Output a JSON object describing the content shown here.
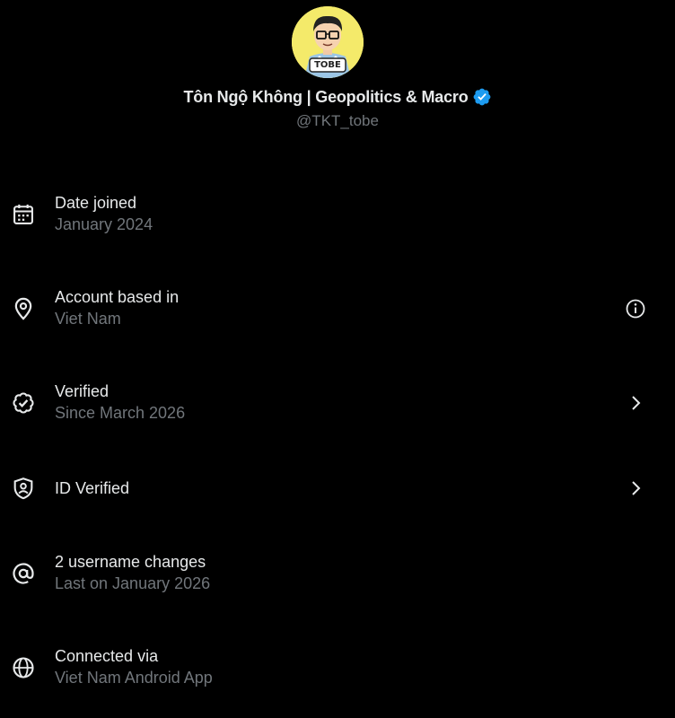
{
  "profile": {
    "display_name": "Tôn Ngộ Không | Geopolitics & Macro",
    "handle": "@TKT_tobe",
    "avatar_text": "TOBE",
    "avatar_bg": "#f4ea6a",
    "verified_color": "#1d9bf0"
  },
  "rows": [
    {
      "icon": "calendar-icon",
      "title": "Date joined",
      "sub": "January 2024"
    },
    {
      "icon": "location-pin-icon",
      "title": "Account based in",
      "sub": "Viet Nam",
      "action": "info-icon"
    },
    {
      "icon": "verified-check-icon",
      "title": "Verified",
      "sub": "Since March 2026",
      "action": "chevron-right-icon"
    },
    {
      "icon": "id-shield-icon",
      "title": "ID Verified",
      "action": "chevron-right-icon"
    },
    {
      "icon": "at-sign-icon",
      "title": "2 username changes",
      "sub": "Last on January 2026"
    },
    {
      "icon": "globe-icon",
      "title": "Connected via",
      "sub": "Viet Nam Android App"
    }
  ],
  "colors": {
    "background": "#000000",
    "primary_text": "#e7e9ea",
    "secondary_text": "#71767b"
  }
}
